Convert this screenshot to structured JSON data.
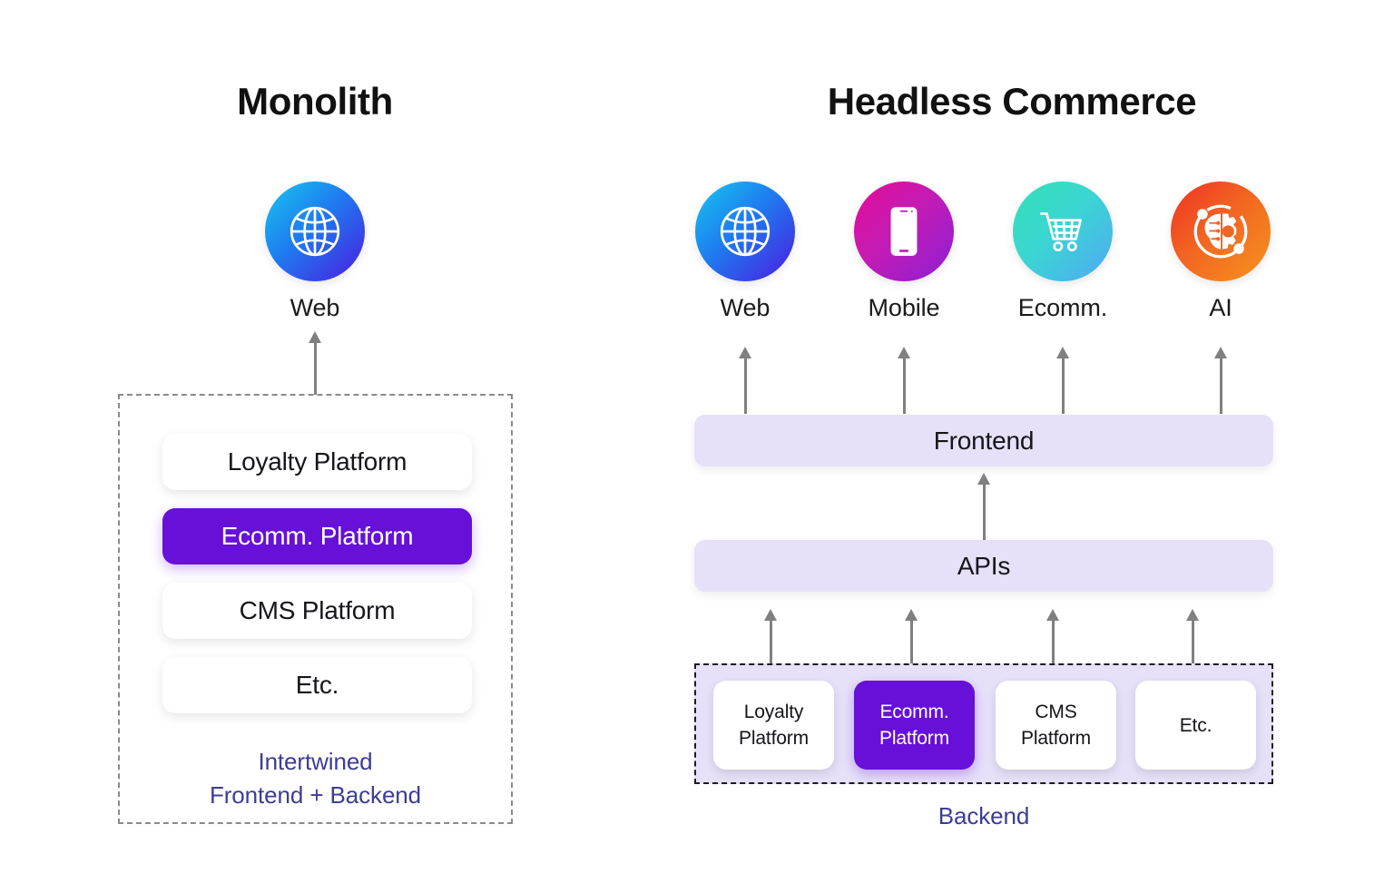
{
  "columns": {
    "monolith": {
      "title": "Monolith",
      "channels": [
        {
          "label": "Web",
          "icon": "globe-icon",
          "gradient_from": "#16C8F0",
          "gradient_to": "#4B1BE0"
        }
      ],
      "stack": [
        {
          "label": "Loyalty Platform",
          "highlighted": false
        },
        {
          "label": "Ecomm. Platform",
          "highlighted": true
        },
        {
          "label": "CMS Platform",
          "highlighted": false
        },
        {
          "label": "Etc.",
          "highlighted": false
        }
      ],
      "caption_line1": "Intertwined",
      "caption_line2": "Frontend + Backend"
    },
    "headless": {
      "title": "Headless Commerce",
      "channels": [
        {
          "label": "Web",
          "icon": "globe-icon",
          "gradient_from": "#16C8F0",
          "gradient_to": "#4B1BE0"
        },
        {
          "label": "Mobile",
          "icon": "smartphone-icon",
          "gradient_from": "#E40B96",
          "gradient_to": "#8B1ED6"
        },
        {
          "label": "Ecomm.",
          "icon": "shopping-cart-icon",
          "gradient_from": "#32E0B4",
          "gradient_to": "#4FA8F5"
        },
        {
          "label": "AI",
          "icon": "ai-brain-gear-icon",
          "gradient_from": "#EF3124",
          "gradient_to": "#F7941E"
        }
      ],
      "layers": [
        {
          "label": "Frontend"
        },
        {
          "label": "APIs"
        }
      ],
      "backend_cards": [
        {
          "line1": "Loyalty",
          "line2": "Platform",
          "highlighted": false
        },
        {
          "line1": "Ecomm.",
          "line2": "Platform",
          "highlighted": true
        },
        {
          "line1": "CMS",
          "line2": "Platform",
          "highlighted": false
        },
        {
          "line1": "Etc.",
          "line2": "",
          "highlighted": false
        }
      ],
      "backend_caption": "Backend"
    }
  },
  "colors": {
    "accent_purple": "#6610D8",
    "layer_lavender": "#E6E1F9",
    "caption_indigo": "#3D3C96",
    "arrow_gray": "#808080",
    "dashed_gray": "#8A8A8A",
    "dashed_black": "#1C1C1C",
    "background": "#FFFFFF"
  }
}
